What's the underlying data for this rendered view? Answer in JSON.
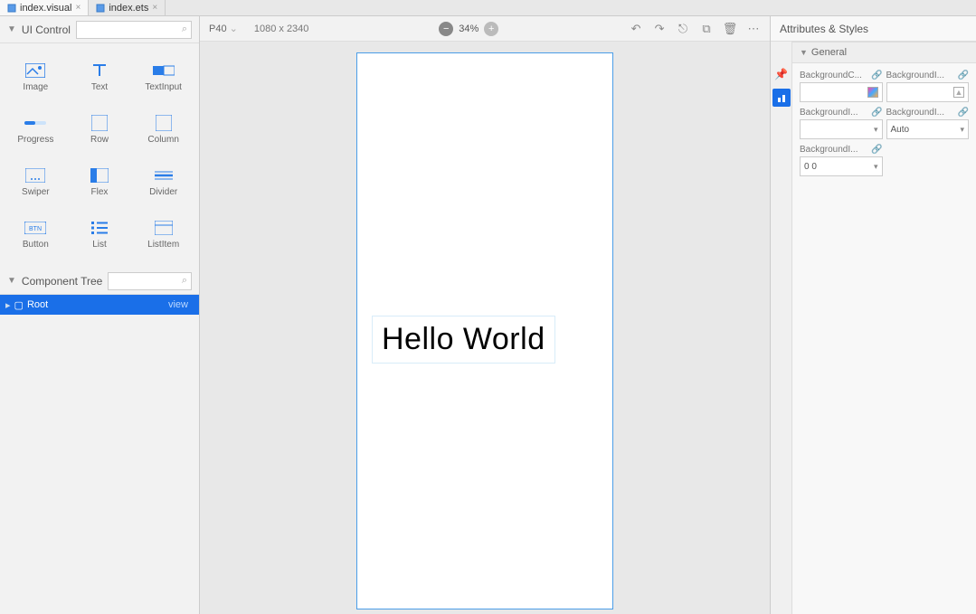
{
  "tabs": [
    {
      "label": "index.visual",
      "active": true
    },
    {
      "label": "index.ets",
      "active": false
    }
  ],
  "ui_control": {
    "title": "UI Control",
    "items": [
      {
        "label": "Image"
      },
      {
        "label": "Text"
      },
      {
        "label": "TextInput"
      },
      {
        "label": "Progress"
      },
      {
        "label": "Row"
      },
      {
        "label": "Column"
      },
      {
        "label": "Swiper"
      },
      {
        "label": "Flex"
      },
      {
        "label": "Divider"
      },
      {
        "label": "Button"
      },
      {
        "label": "List"
      },
      {
        "label": "ListItem"
      }
    ]
  },
  "component_tree": {
    "title": "Component Tree",
    "root_label": "Root",
    "root_type": "view"
  },
  "toolbar": {
    "device": "P40",
    "dimensions": "1080 x 2340",
    "zoom": "34%"
  },
  "canvas": {
    "text_content": "Hello World"
  },
  "attributes": {
    "title": "Attributes & Styles",
    "general": "General",
    "props": {
      "p0": "BackgroundC...",
      "p1": "BackgroundI...",
      "p2": "BackgroundI...",
      "p3": "BackgroundI...",
      "p3v": "Auto",
      "p4": "BackgroundI...",
      "p4v": "0 0"
    }
  }
}
